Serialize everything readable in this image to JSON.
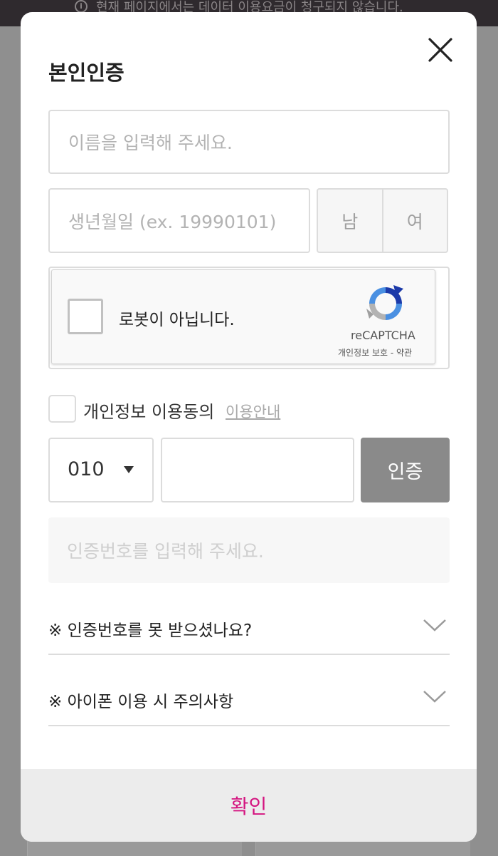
{
  "top_notice": {
    "icon": "info-icon",
    "icon_glyph": "i",
    "text": "현재 페이지에서는 데이터 이용요금이 청구되지 않습니다."
  },
  "modal": {
    "title": "본인인증",
    "close_icon": "close-icon",
    "name_placeholder": "이름을 입력해 주세요.",
    "birth_placeholder": "생년월일 (ex. 19990101)",
    "gender_options": [
      "남",
      "여"
    ],
    "recaptcha": {
      "label": "로봇이 아닙니다.",
      "brand": "reCAPTCHA",
      "links": "개인정보 보호 - 약관",
      "logo_icon": "recaptcha-logo-icon"
    },
    "consent": {
      "label": "개인정보 이용동의",
      "link": "이용안내",
      "checked": false
    },
    "carrier_selected": "010",
    "phone_value": "",
    "verify_button": "인증",
    "code_placeholder": "인증번호를 입력해 주세요.",
    "accordions": [
      {
        "label": "※ 인증번호를 못 받으셨나요?"
      },
      {
        "label": "※ 아이폰 이용 시 주의사항"
      }
    ],
    "confirm_button": "확인"
  },
  "colors": {
    "accent": "#d4137f",
    "verify_button_bg": "#8a8a8a",
    "overlay": "#8f8f8f",
    "top_bar": "#2f2a2e"
  }
}
